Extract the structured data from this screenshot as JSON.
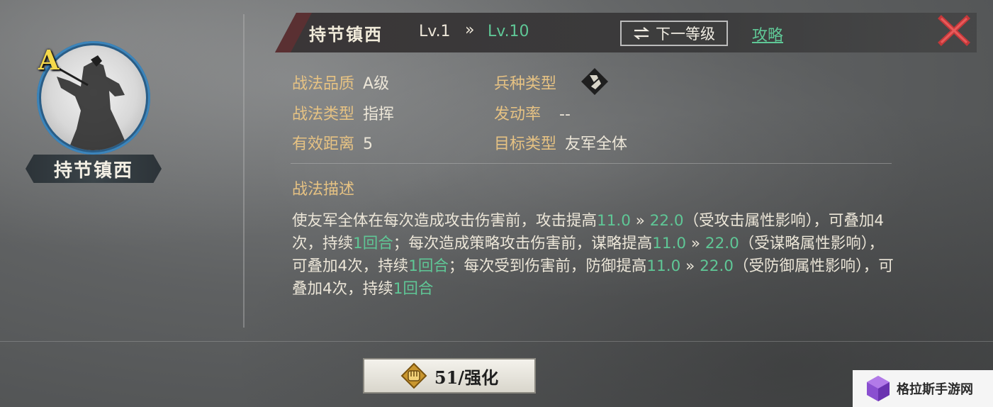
{
  "portrait": {
    "grade": "A",
    "name": "持节镇西"
  },
  "header": {
    "skill_name": "持节镇西",
    "level_current": "Lv.1",
    "level_arrow": "»",
    "level_max": "Lv.10",
    "next_level_label": "下一等级",
    "guide_label": "攻略"
  },
  "attributes": {
    "quality_key": "战法品质",
    "quality_val": "A级",
    "troop_key": "兵种类型",
    "type_key": "战法类型",
    "type_val": "指挥",
    "rate_key": "发动率",
    "rate_val": "--",
    "range_key": "有效距离",
    "range_val": "5",
    "target_key": "目标类型",
    "target_val": "友军全体"
  },
  "description": {
    "title": "战法描述",
    "parts": [
      "使友军全体在每次造成攻击伤害前，攻击提高",
      "11.0",
      " » ",
      "22.0",
      "（受攻击属性影响），可叠加4次，持续",
      "1回合",
      "；每次造成策略攻击伤害前，谋略提高",
      "11.0",
      " » ",
      "22.0",
      "（受谋略属性影响），可叠加4次，持续",
      "1回合",
      "；每次受到伤害前，防御提高",
      "11.0",
      " » ",
      "22.0",
      "（受防御属性影响），可叠加4次，持续",
      "1回合"
    ]
  },
  "upgrade_button": {
    "label": "51/强化"
  },
  "watermark": {
    "text": "格拉斯手游网"
  },
  "colors": {
    "accent_green": "#5fc796",
    "label_gold": "#e6c283",
    "grade_yellow": "#f5d94a",
    "ring_blue": "#2a5d86"
  }
}
